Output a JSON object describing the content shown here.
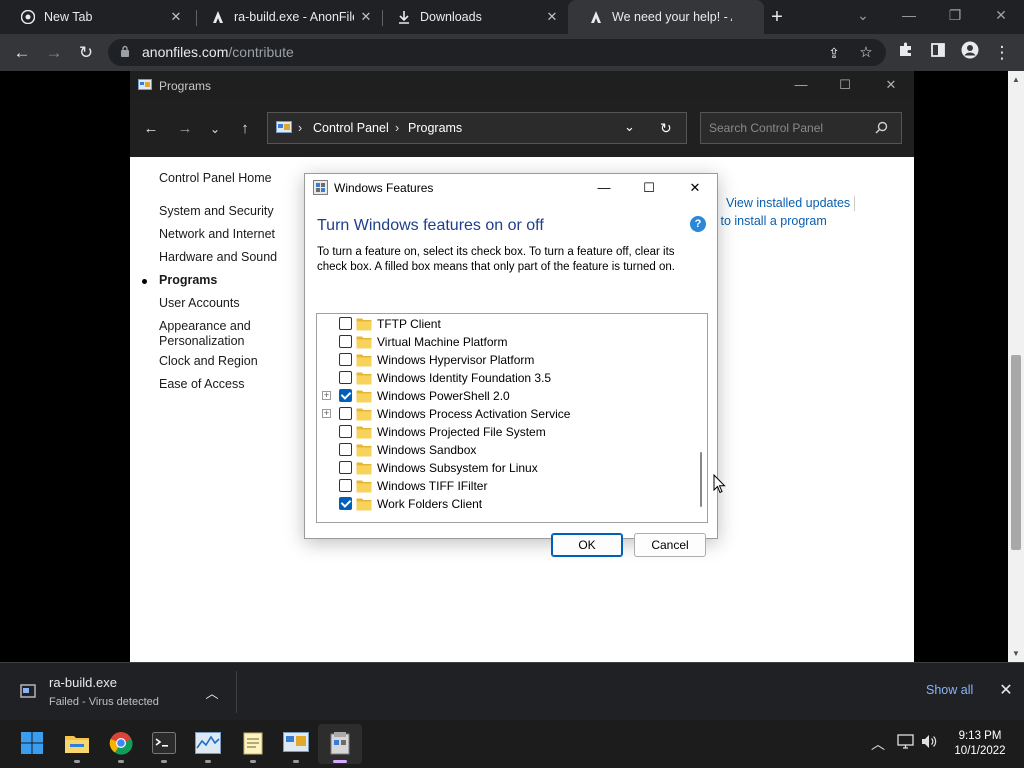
{
  "browser": {
    "tabs": [
      {
        "label": "New Tab",
        "icon": "chrome-icon"
      },
      {
        "label": "ra-build.exe - AnonFile",
        "icon": "anonfiles-icon"
      },
      {
        "label": "Downloads",
        "icon": "download-icon"
      },
      {
        "label": "We need your help! - A",
        "icon": "anonfiles-icon",
        "active": true
      }
    ],
    "url_domain": "anonfiles.com",
    "url_path": "/contribute"
  },
  "control_panel": {
    "title": "Programs",
    "breadcrumb": [
      "Control Panel",
      "Programs"
    ],
    "search_placeholder": "Search Control Panel",
    "left_nav": [
      {
        "label": "Control Panel Home"
      },
      {
        "label": "System and Security"
      },
      {
        "label": "Network and Internet"
      },
      {
        "label": "Hardware and Sound"
      },
      {
        "label": "Programs",
        "current": true
      },
      {
        "label": "User Accounts"
      },
      {
        "label": "Appearance and Personalization"
      },
      {
        "label": "Clock and Region"
      },
      {
        "label": "Ease of Access"
      }
    ],
    "links": {
      "view_updates": "View installed updates",
      "how_install": "w to install a program"
    }
  },
  "windows_features": {
    "title": "Windows Features",
    "heading": "Turn Windows features on or off",
    "description": "To turn a feature on, select its check box. To turn a feature off, clear its check box. A filled box means that only part of the feature is turned on.",
    "features": [
      {
        "label": "TFTP Client",
        "checked": false,
        "expandable": false
      },
      {
        "label": "Virtual Machine Platform",
        "checked": false,
        "expandable": false
      },
      {
        "label": "Windows Hypervisor Platform",
        "checked": false,
        "expandable": false
      },
      {
        "label": "Windows Identity Foundation 3.5",
        "checked": false,
        "expandable": false
      },
      {
        "label": "Windows PowerShell 2.0",
        "checked": true,
        "expandable": true
      },
      {
        "label": "Windows Process Activation Service",
        "checked": false,
        "expandable": true
      },
      {
        "label": "Windows Projected File System",
        "checked": false,
        "expandable": false
      },
      {
        "label": "Windows Sandbox",
        "checked": false,
        "expandable": false
      },
      {
        "label": "Windows Subsystem for Linux",
        "checked": false,
        "expandable": false
      },
      {
        "label": "Windows TIFF IFilter",
        "checked": false,
        "expandable": false
      },
      {
        "label": "Work Folders Client",
        "checked": true,
        "expandable": false
      }
    ],
    "ok_label": "OK",
    "cancel_label": "Cancel",
    "help_glyph": "?"
  },
  "download_bar": {
    "file_name": "ra-build.exe",
    "status": "Failed - Virus detected",
    "show_all": "Show all"
  },
  "taskbar": {
    "time": "9:13 PM",
    "date": "10/1/2022"
  },
  "colors": {
    "accent": "#005fb8",
    "link": "#0a5fb0",
    "heading": "#1e3f8a",
    "chrome_dark": "#202124",
    "show_all": "#8ab4f8"
  }
}
